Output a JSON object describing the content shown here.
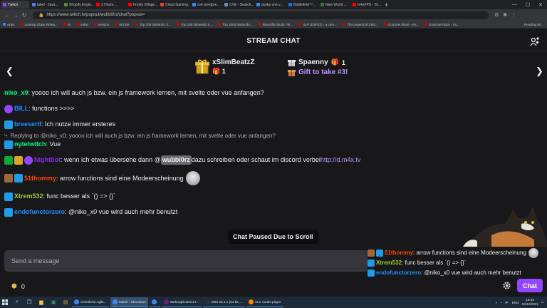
{
  "browser": {
    "tabs": [
      {
        "label": "Twitch",
        "color": "#9147ff",
        "active": true
      },
      {
        "label": "label - Java...",
        "color": "#4285f4"
      },
      {
        "label": "Shopify Engin...",
        "color": "#5e8e3e"
      },
      {
        "label": "2 Hours ...",
        "color": "#ff0000"
      },
      {
        "label": "Frosty Village...",
        "color": "#ff0000"
      },
      {
        "label": "Cloud Gaming...",
        "color": "#ea4335"
      },
      {
        "label": "cve wordpre...",
        "color": "#4285f4"
      },
      {
        "label": "CVE - Search...",
        "color": "#6d8ebd"
      },
      {
        "label": "dusky one v...",
        "color": "#4285f4"
      },
      {
        "label": "Battlefield™...",
        "color": "#1a73e8"
      },
      {
        "label": "New World ...",
        "color": "#2e7d32"
      },
      {
        "label": "m4xFPS - Yo...",
        "color": "#ff0000"
      }
    ],
    "new_tab": "+",
    "url": "https://www.twitch.tv/popout/wubbl0rz/chat?popout=",
    "bookmarks": [
      "Apps",
      "Looking Glass Relea...",
      "ss",
      "kekw",
      "session",
      "MUSIK",
      "Top 100 Nintendo S...",
      "Top 100 Nintendo S...",
      "Top 1000 Nintendo...",
      "Beautiful Study / M...",
      "ULP (ESP32) - a com...",
      "The Legend of Zeld...",
      "Gourmet Race - Kir...",
      "Gourmet Race - Su..."
    ],
    "reading_list": "Reading list"
  },
  "header": {
    "title": "STREAM CHAT"
  },
  "hype": {
    "left_user": "xSlimBeatzZ",
    "left_count": "1",
    "right_user": "Spaenny",
    "right_count": "1",
    "right_cta": "Gift to take #3!"
  },
  "messages": [
    {
      "badges": [],
      "name": "niko_x0",
      "color": "#00ff7f",
      "text": ": yoooo ich will auch js bzw. ein js framework lernen, mit svelte oder vue anfangen?"
    },
    {
      "badges": [
        "b-purple"
      ],
      "name": "BILL",
      "color": "#1e90ff",
      "text": ": functions >>>>"
    },
    {
      "badges": [
        "b-crown"
      ],
      "name": "breeserif",
      "color": "#1e90ff",
      "text": ": Ich nutze immer ersteres"
    },
    {
      "reply": "Replying to @niko_x0: yoooo ich will auch js bzw. ein js framework lernen, mit svelte oder vue anfangen?",
      "badges": [
        "b-twitch"
      ],
      "name": "nytetwitch",
      "color": "#00ff7f",
      "text": ": Vue"
    },
    {
      "badges": [
        "b-mod",
        "b-gold",
        "b-purple"
      ],
      "name": "Nightbot",
      "color": "#8a2be2",
      "text_a": ": wenn ich etwas übersehe dann @",
      "mention": "wubbl0rz",
      "text_b": " dazu schreiben oder schaut im discord vorbei ",
      "link": "http://d.m4x.tv"
    },
    {
      "badges": [
        "b-brown",
        "b-crown"
      ],
      "name": "51thommy",
      "color": "#ff4500",
      "text": ": arrow functions sind eine Modeerscheinung",
      "emote": true
    },
    {
      "badges": [
        "b-crown"
      ],
      "name": "Xtrem532",
      "color": "#9acd32",
      "text": ": func besser als `() => {}`"
    },
    {
      "badges": [
        "b-crown"
      ],
      "name": "endofunctorzero",
      "color": "#1e90ff",
      "text": ": @niko_x0 vue wird auch mehr benutzt"
    }
  ],
  "paused_label": "Chat Paused Due to Scroll",
  "composer": {
    "placeholder": "Send a message"
  },
  "overlay": [
    {
      "name": "51thommy",
      "color": "#ff4500",
      "text": ": arrow functions sind eine Modeerscheinung"
    },
    {
      "name": "Xtrem532",
      "color": "#9acd32",
      "text": ": func besser als `() => {}`"
    },
    {
      "name": "endofunctorzero",
      "color": "#1e90ff",
      "text": ": @niko_x0 vue wird auch mehr benutzt"
    }
  ],
  "bottom": {
    "points": "0",
    "chat_button": "Chat"
  },
  "taskbar": {
    "apps": [
      {
        "label": "Christliche Agile...",
        "color": "#4285f4"
      },
      {
        "label": "Twitch - Chromium",
        "color": "#4285f4",
        "active": true
      },
      {
        "label": "",
        "color": "#4285f4"
      },
      {
        "label": "WebApplication17...",
        "color": "#68217a"
      },
      {
        "label": "OBS 26.1.1 (64-bit, ...",
        "color": "#302e31"
      },
      {
        "label": "VLC media player",
        "color": "#ff8800"
      }
    ],
    "lang": "ENG",
    "time": "18:45",
    "date": "22/12/2021"
  }
}
